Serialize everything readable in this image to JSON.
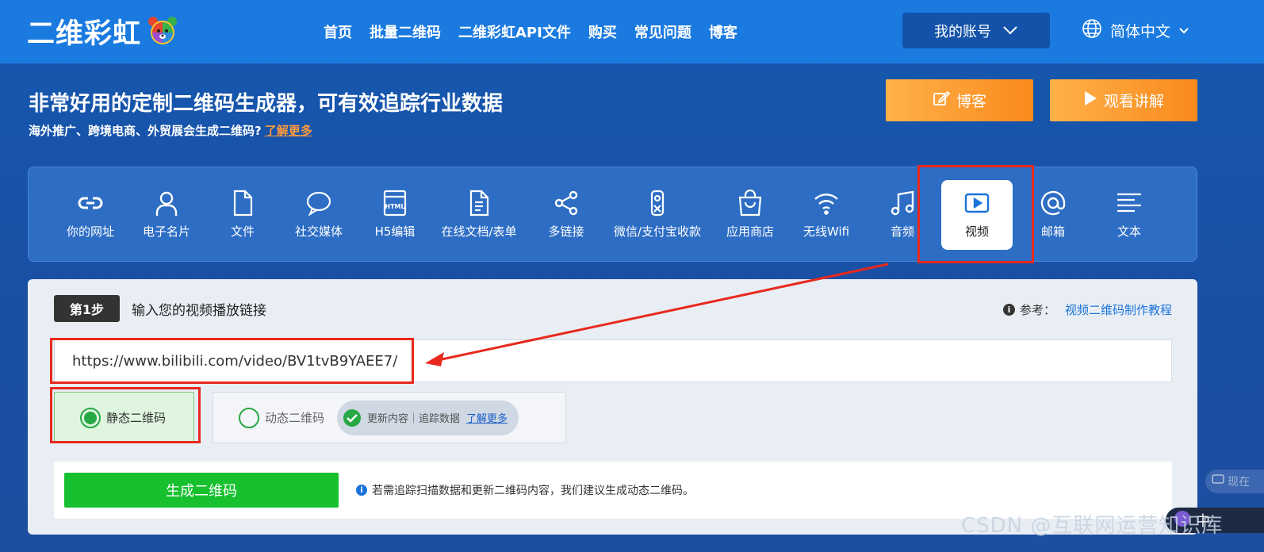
{
  "header": {
    "logo_text": "二维彩虹",
    "nav": [
      "首页",
      "批量二维码",
      "二维彩虹API文件",
      "购买",
      "常见问题",
      "博客"
    ],
    "account_label": "我的账号",
    "language_label": "简体中文"
  },
  "hero": {
    "title": "非常好用的定制二维码生成器，可有效追踪行业数据",
    "subtitle": "海外推广、跨境电商、外贸展会生成二维码?",
    "learn_more": "了解更多",
    "blog_button": "博客",
    "watch_button": "观看讲解"
  },
  "types": [
    {
      "label": "你的网址",
      "icon": "link-icon"
    },
    {
      "label": "电子名片",
      "icon": "person-icon"
    },
    {
      "label": "文件",
      "icon": "file-icon"
    },
    {
      "label": "社交媒体",
      "icon": "chat-bubble-icon"
    },
    {
      "label": "H5编辑",
      "icon": "html-icon"
    },
    {
      "label": "在线文档/表单",
      "icon": "document-icon"
    },
    {
      "label": "多链接",
      "icon": "share-icon"
    },
    {
      "label": "微信/支付宝收款",
      "icon": "payment-icon"
    },
    {
      "label": "应用商店",
      "icon": "shopping-bag-icon"
    },
    {
      "label": "无线Wifi",
      "icon": "wifi-icon"
    },
    {
      "label": "音频",
      "icon": "music-note-icon"
    },
    {
      "label": "视频",
      "icon": "video-play-icon",
      "active": true
    },
    {
      "label": "邮箱",
      "icon": "at-sign-icon"
    },
    {
      "label": "文本",
      "icon": "text-lines-icon"
    }
  ],
  "step": {
    "badge": "第1步",
    "instruction": "输入您的视频播放链接",
    "ref_label": "参考：",
    "ref_link": "视频二维码制作教程",
    "url_value": "https://www.bilibili.com/video/BV1tvB9YAEE7/"
  },
  "options": {
    "static_label": "静态二维码",
    "dynamic_label": "动态二维码",
    "pill_text": "更新内容｜追踪数据",
    "pill_link": "了解更多",
    "static_selected": true
  },
  "generate": {
    "button_label": "生成二维码",
    "tip": "若需追踪扫描数据和更新二维码内容，我们建议生成动态二维码。"
  },
  "overlay": {
    "watermark": "CSDN @互联网运营知识库",
    "float_label": "现在",
    "float2_label": "中"
  },
  "colors": {
    "topbar": "#1a7ae0",
    "accent_orange": "#f98a1c",
    "green": "#16c02e",
    "annotation_red": "#e8291e"
  }
}
